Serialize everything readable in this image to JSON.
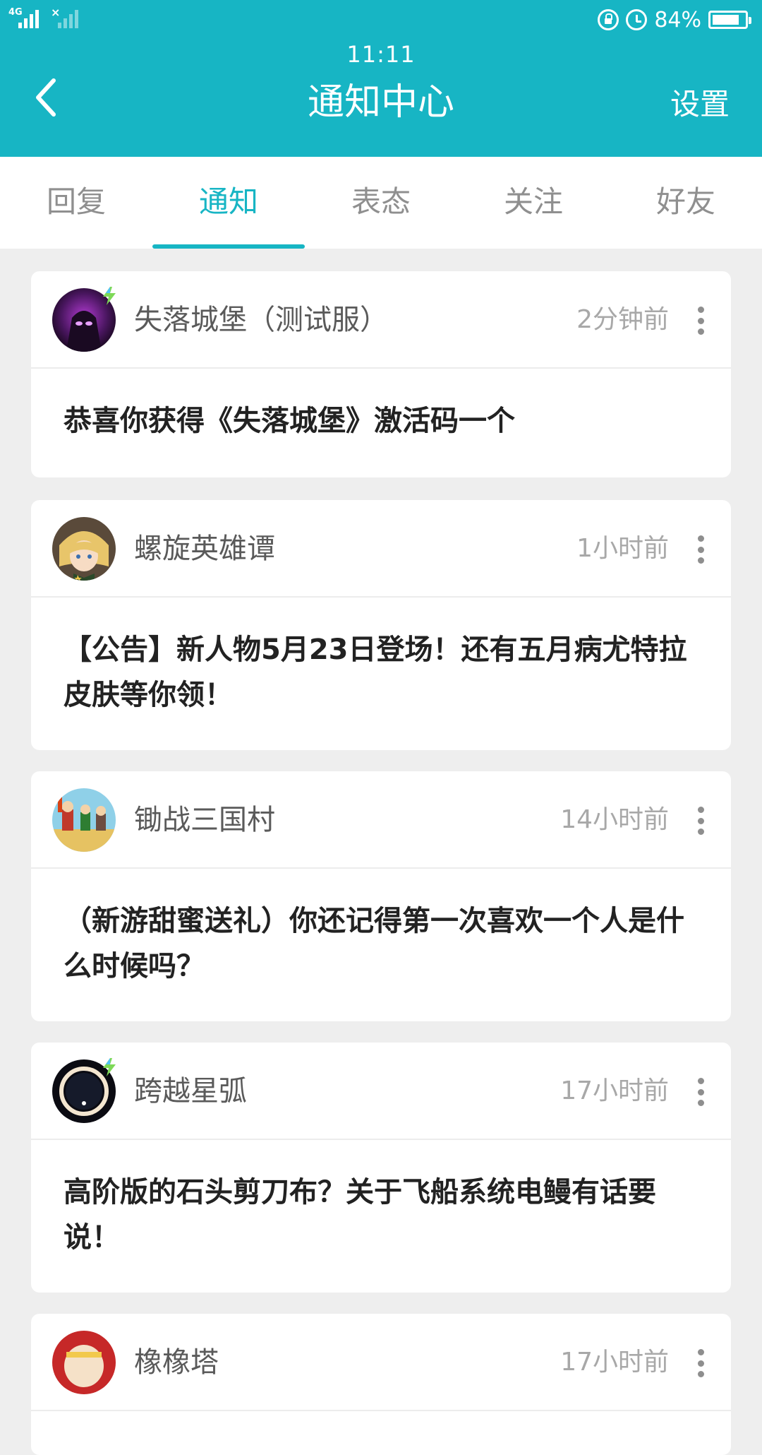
{
  "status_bar": {
    "network_label": "4G",
    "time": "11:11",
    "battery_percent": "84%",
    "battery_level": 0.84
  },
  "header": {
    "title": "通知中心",
    "settings_label": "设置"
  },
  "tabs": [
    {
      "label": "回复",
      "active": false
    },
    {
      "label": "通知",
      "active": true
    },
    {
      "label": "表态",
      "active": false
    },
    {
      "label": "关注",
      "active": false
    },
    {
      "label": "好友",
      "active": false
    }
  ],
  "notifications": [
    {
      "sender": "失落城堡（测试服）",
      "time": "2分钟前",
      "message": "恭喜你获得《失落城堡》激活码一个",
      "avatar_icon": "dark-knight-avatar",
      "badge_icon": "lightning-badge-icon"
    },
    {
      "sender": "螺旋英雄谭",
      "time": "1小时前",
      "message": "【公告】新人物5月23日登场！还有五月病尤特拉皮肤等你领！",
      "avatar_icon": "anime-girl-avatar",
      "badge_icon": ""
    },
    {
      "sender": "锄战三国村",
      "time": "14小时前",
      "message": "（新游甜蜜送礼）你还记得第一次喜欢一个人是什么时候吗？",
      "avatar_icon": "three-kingdoms-avatar",
      "badge_icon": ""
    },
    {
      "sender": "跨越星弧",
      "time": "17小时前",
      "message": "高阶版的石头剪刀布？关于飞船系统电鳗有话要说！",
      "avatar_icon": "star-arc-avatar",
      "badge_icon": "lightning-badge-icon"
    },
    {
      "sender": "橡橡塔",
      "time": "17小时前",
      "message": "",
      "avatar_icon": "red-mask-avatar",
      "badge_icon": ""
    }
  ]
}
